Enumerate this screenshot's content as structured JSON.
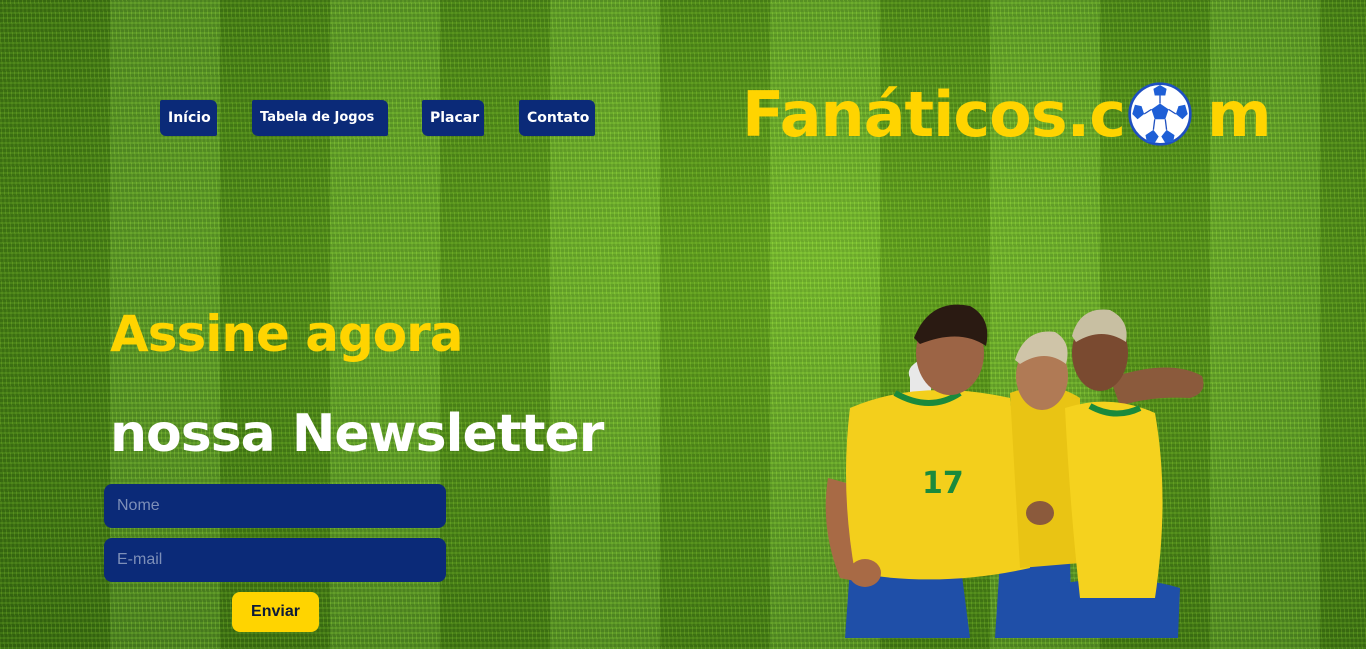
{
  "nav": {
    "items": [
      {
        "label": "Início"
      },
      {
        "label": "Tabela de Jogos"
      },
      {
        "label": "Placar"
      },
      {
        "label": "Contato"
      }
    ]
  },
  "logo": {
    "text_before": "Fanáticos.c",
    "text_after": "m",
    "icon": "soccer-ball-icon"
  },
  "hero": {
    "headline_1": "Assine agora",
    "headline_2": "nossa Newsletter"
  },
  "form": {
    "name_placeholder": "Nome",
    "email_placeholder": "E-mail",
    "submit_label": "Enviar"
  },
  "image": {
    "subject": "players-celebrating-image"
  },
  "colors": {
    "accent_yellow": "#ffd400",
    "navy": "#0b2a78",
    "grass_green": "#5a9a1e"
  }
}
